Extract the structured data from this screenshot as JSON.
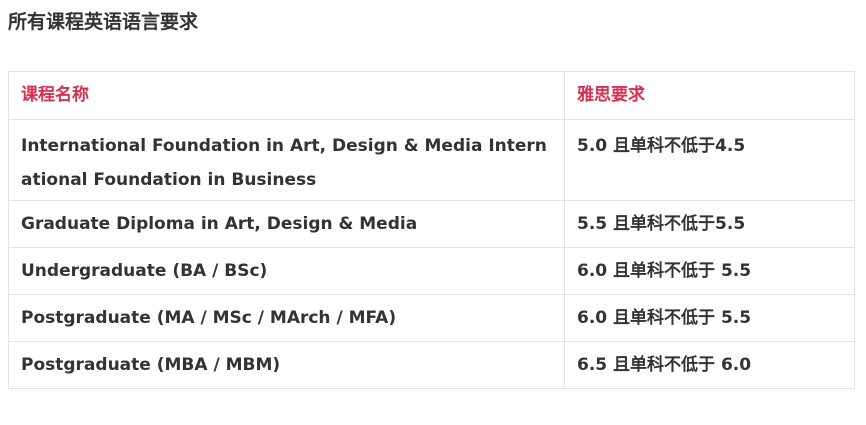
{
  "title": "所有课程英语语言要求",
  "table": {
    "headers": {
      "course": "课程名称",
      "ielts": "雅思要求"
    },
    "rows": [
      {
        "course": "International Foundation in Art, Design & Media International Foundation in Business",
        "requirement": "5.0 且单科不低于4.5"
      },
      {
        "course": "Graduate Diploma in Art, Design & Media",
        "requirement": "5.5 且单科不低于5.5"
      },
      {
        "course": "Undergraduate (BA / BSc)",
        "requirement": "6.0 且单科不低于 5.5"
      },
      {
        "course": "Postgraduate (MA / MSc / MArch / MFA)",
        "requirement": "6.0 且单科不低于 5.5"
      },
      {
        "course": "Postgraduate (MBA / MBM)",
        "requirement": "6.5 且单科不低于 6.0"
      }
    ]
  },
  "colors": {
    "header_text": "#d9304f",
    "body_text": "#333333",
    "border": "#e3e3e3"
  }
}
